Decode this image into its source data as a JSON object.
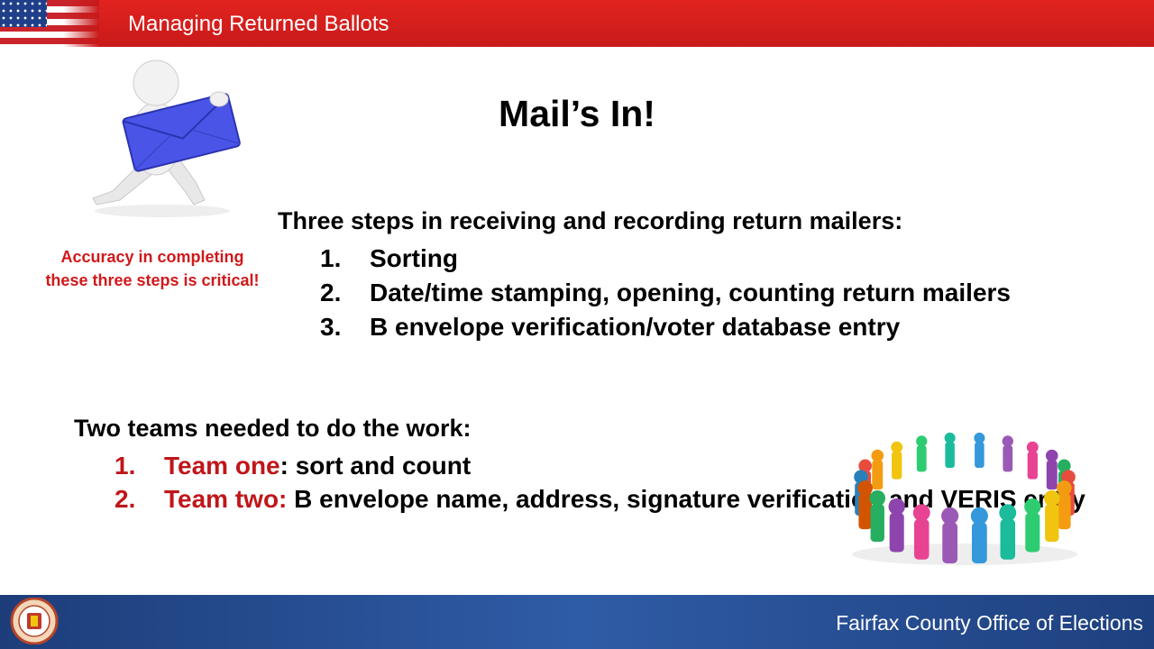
{
  "header": {
    "title": "Managing Returned Ballots"
  },
  "slide": {
    "title": "Mail’s In!"
  },
  "note": "Accuracy in completing these three steps is critical!",
  "steps": {
    "heading": "Three steps in receiving and recording return mailers:",
    "items": [
      {
        "number": "1.",
        "text": "Sorting"
      },
      {
        "number": "2.",
        "text": "Date/time stamping, opening, counting return mailers"
      },
      {
        "number": "3.",
        "text": "B envelope verification/voter database entry"
      }
    ]
  },
  "teams": {
    "heading": "Two teams needed to do the work:",
    "items": [
      {
        "number": "1.",
        "name": "Team one",
        "text": ": sort and count"
      },
      {
        "number": "2.",
        "name": "Team two:",
        "text": " B envelope name, address, signature verification and VERIS entry"
      }
    ]
  },
  "footer": {
    "org": "Fairfax County Office of Elections"
  },
  "icons": {
    "flag": "us-flag-icon",
    "mail": "mail-carrier-figure",
    "team": "team-circle-figure",
    "seal": "county-seal-icon"
  },
  "colors": {
    "header_red": "#e2231f",
    "footer_blue": "#2f5ca6",
    "accent_red": "#c0161a",
    "envelope_blue": "#4a55e8"
  }
}
